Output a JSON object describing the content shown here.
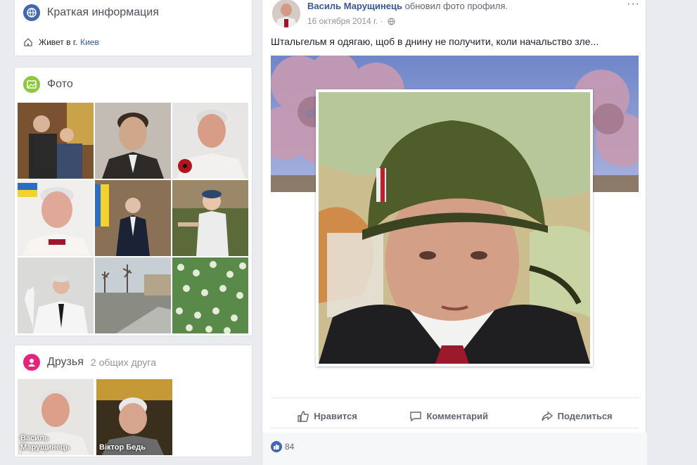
{
  "colors": {
    "link": "#365899",
    "accent": "#4267b2",
    "muted": "#90949c"
  },
  "intro": {
    "icon": "globe-icon",
    "title": "Краткая информация",
    "lives_label": "Живет в г.",
    "lives_city": "Киев"
  },
  "photos": {
    "icon": "photo-icon",
    "title": "Фото"
  },
  "friends": {
    "icon": "friends-icon",
    "title": "Друзья",
    "mutual": "2 общих друга",
    "items": [
      {
        "name": "Василь Марущинець"
      },
      {
        "name": "Віктор Бедь"
      }
    ]
  },
  "post": {
    "author": "Василь Марущинець",
    "action": "обновил фото профиля.",
    "date": "16 октября 2014 г. ·",
    "privacy_icon": "globe-icon",
    "more": "···",
    "text": "Штальгельм я одягаю, щоб в днину не получити, коли начальство зле...",
    "actions": {
      "like": "Нравится",
      "comment": "Комментарий",
      "share": "Поделиться"
    },
    "likes_count": "84"
  }
}
